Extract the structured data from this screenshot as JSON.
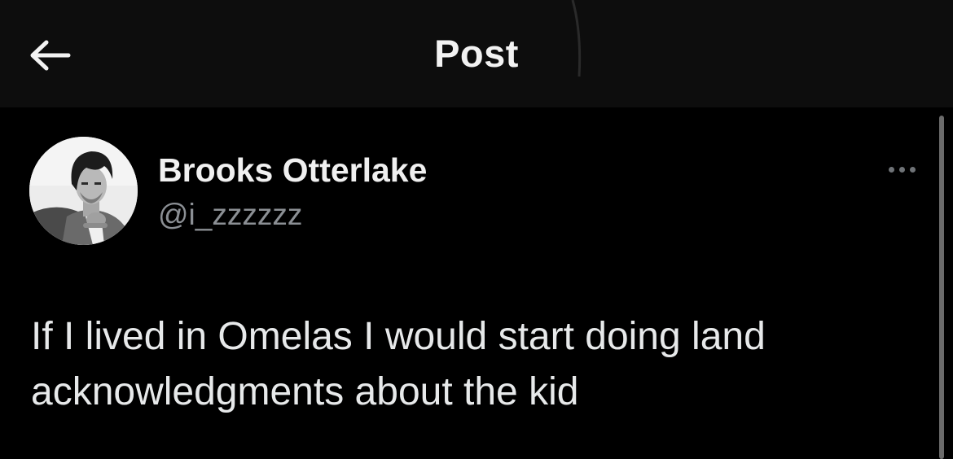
{
  "header": {
    "title": "Post",
    "back_icon": "arrow-left-icon"
  },
  "author": {
    "display_name": "Brooks Otterlake",
    "handle": "@i_zzzzzz",
    "avatar_icon": "avatar-photo"
  },
  "post": {
    "text": "If I lived in Omelas I would start doing land\nacknowledgments about the kid"
  },
  "more_icon": "ellipsis-icon",
  "colors": {
    "background": "#000000",
    "header_background": "#0d0d0d",
    "primary_text": "#e7e9ea",
    "secondary_text": "#8b8f94",
    "scrollbar": "#6b6b6b"
  }
}
